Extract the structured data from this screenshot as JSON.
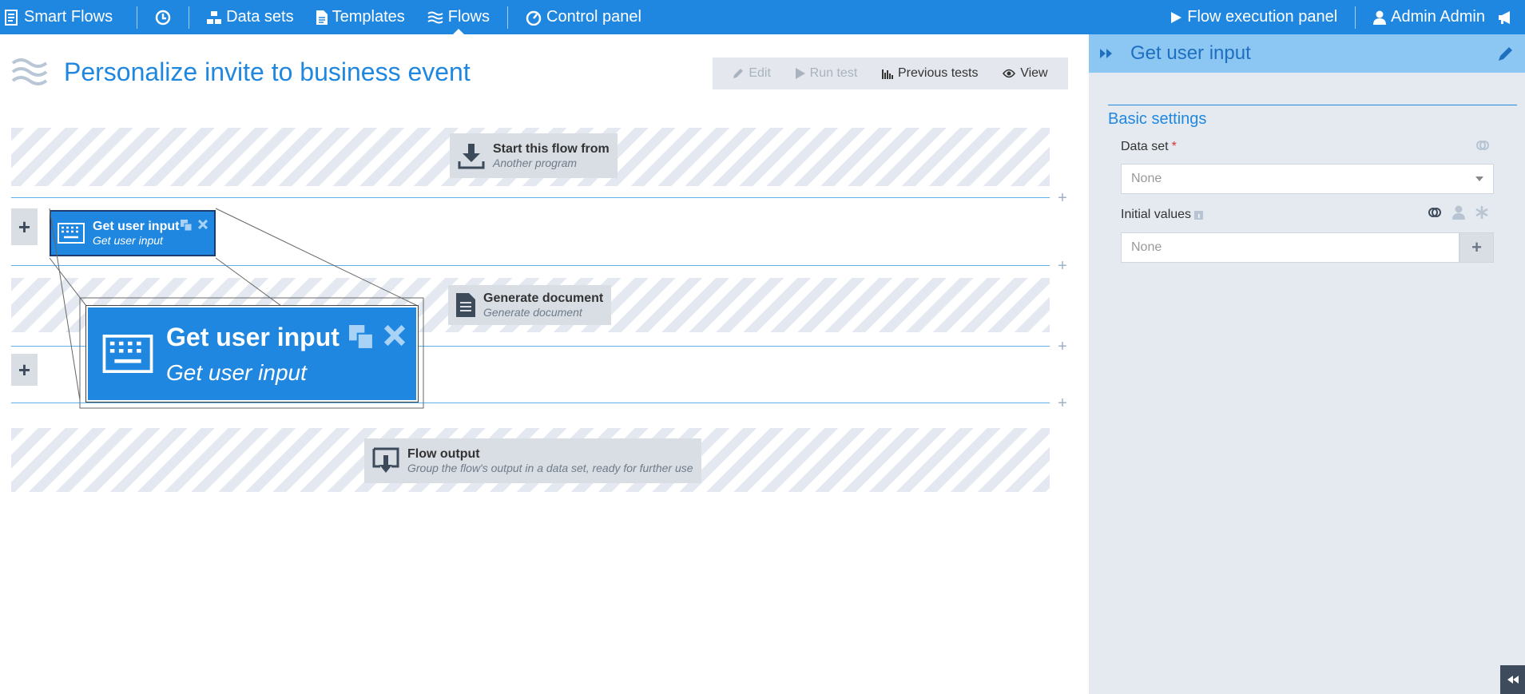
{
  "colors": {
    "brand": "#1f87e0",
    "panel_head": "#8cc6f2",
    "node_bg": "#d9dee5",
    "required": "#e03030"
  },
  "nav": {
    "brand": "Smart Flows",
    "history_icon": "clock-icon",
    "items": [
      {
        "label": "Data sets",
        "icon": "sitemap-icon"
      },
      {
        "label": "Templates",
        "icon": "file-icon"
      },
      {
        "label": "Flows",
        "icon": "waves-icon",
        "active": true
      },
      {
        "label": "Control panel",
        "icon": "gauge-icon"
      }
    ],
    "execution_panel": "Flow execution panel",
    "user": "Admin Admin"
  },
  "page": {
    "title": "Personalize invite to business event"
  },
  "toolbar": {
    "edit": "Edit",
    "run_test": "Run test",
    "previous_tests": "Previous tests",
    "view": "View"
  },
  "flow": {
    "start_node": {
      "title": "Start this flow from",
      "subtitle": "Another program"
    },
    "selected_node": {
      "title": "Get user input",
      "subtitle": "Get user input"
    },
    "generate_node": {
      "title": "Generate document",
      "subtitle": "Generate document"
    },
    "output_node": {
      "title": "Flow output",
      "subtitle": "Group the flow's output in a data set, ready for further use"
    },
    "plus": "+"
  },
  "panel": {
    "title": "Get user input",
    "section": "Basic settings",
    "data_set_label": "Data set",
    "required_mark": "*",
    "data_set_value": "None",
    "initial_values_label": "Initial values",
    "initial_values_placeholder": "None",
    "add": "+"
  }
}
